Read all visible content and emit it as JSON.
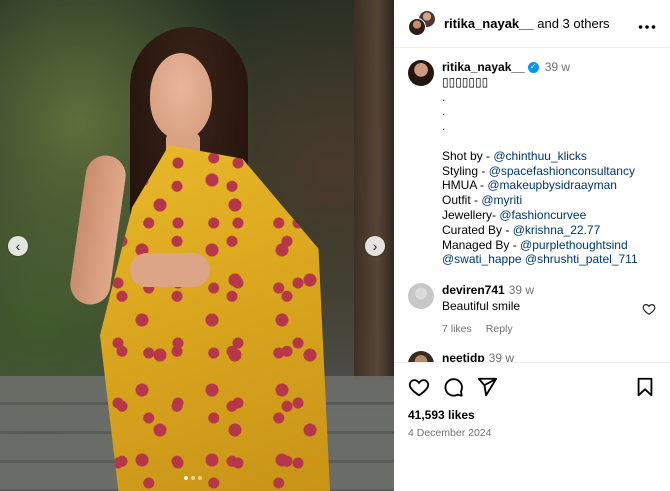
{
  "header": {
    "username": "ritika_nayak__",
    "others_text": "and 3 others",
    "more_icon": "more-horizontal-icon"
  },
  "caption": {
    "username": "ritika_nayak__",
    "time": "39 w",
    "emoji_line": "▯▯▯▯▯▯▯",
    "dots": [
      ".",
      ".",
      "."
    ],
    "credits": [
      {
        "label": "Shot by - ",
        "mention": "@chinthuu_klicks"
      },
      {
        "label": "Styling - ",
        "mention": "@spacefashionconsultancy"
      },
      {
        "label": "HMUA - ",
        "mention": "@makeupbysidraayman"
      },
      {
        "label": "Outfit - ",
        "mention": "@myriti"
      },
      {
        "label": "Jewellery- ",
        "mention": "@fashioncurvee"
      },
      {
        "label": "Curated By - ",
        "mention": "@krishna_22.77"
      },
      {
        "label": "Managed By - ",
        "mention": "@purplethoughtsind"
      }
    ],
    "extra_mentions": [
      "@swati_happe",
      "@shrushti_patel_711"
    ]
  },
  "comment": {
    "username": "deviren741",
    "time": "39 w",
    "text": "Beautiful smile",
    "likes": "7 likes",
    "reply": "Reply"
  },
  "partial_comment": {
    "username": "neetidp",
    "time": "39 w"
  },
  "actions": {
    "likes": "41,593 likes",
    "date": "4 December 2024"
  },
  "carousel": {
    "prev": "‹",
    "next": "›"
  }
}
